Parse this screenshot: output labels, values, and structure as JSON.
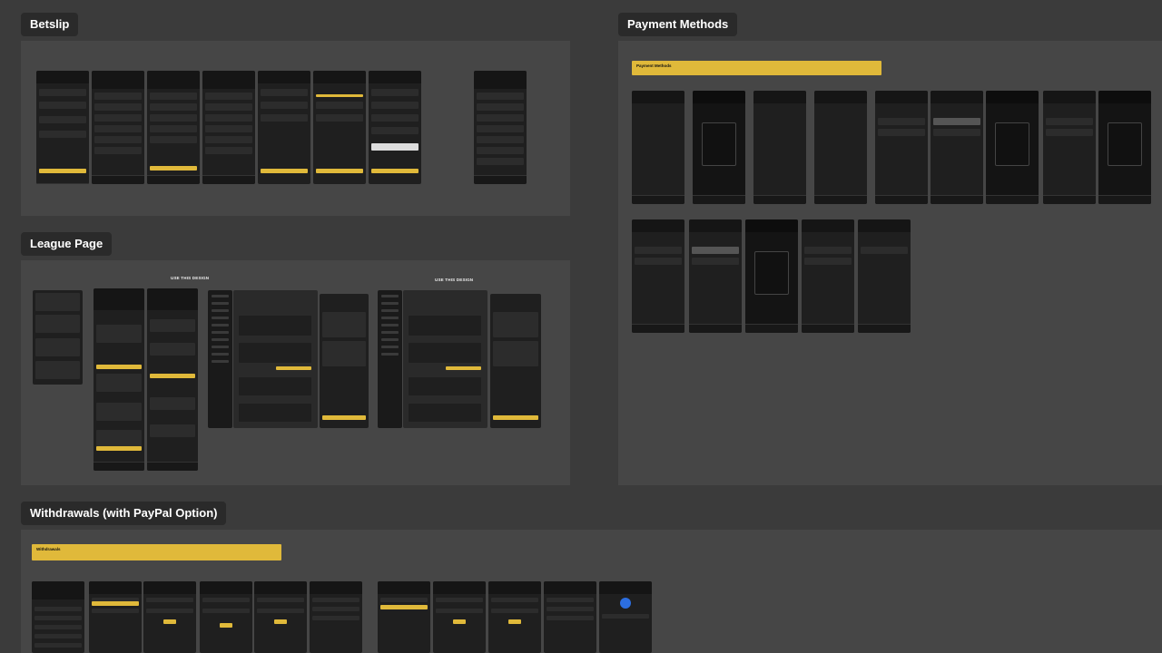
{
  "sections": {
    "betslip": {
      "label": "Betslip"
    },
    "payment_methods": {
      "label": "Payment Methods"
    },
    "league_page": {
      "label": "League Page"
    },
    "withdrawals": {
      "label": "Withdrawals (with PayPal Option)"
    }
  },
  "league_notes": [
    "USE THIS DESIGN",
    "USE THIS DESIGN"
  ],
  "banners": {
    "payment": {
      "title": "Payment Methods"
    },
    "withdrawals": {
      "title": "Withdrawals"
    }
  },
  "colors": {
    "canvas": "#3b3b3b",
    "frame": "#464646",
    "accent": "#e0b93a",
    "screen": "#1f1f1f"
  }
}
